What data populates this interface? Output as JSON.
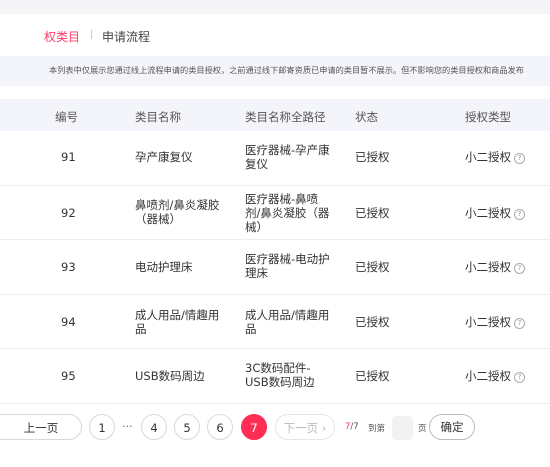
{
  "tabs": {
    "active": "权类目",
    "other": "申请流程"
  },
  "notice": "本列表中仅展示您通过线上流程申请的类目授权，之前通过线下邮寄资质已申请的类目暂不展示。但不影响您的类目授权和商品发布",
  "table": {
    "headers": [
      "编号",
      "类目名称",
      "类目名称全路径",
      "状态",
      "授权类型"
    ],
    "rows": [
      {
        "id": "91",
        "name": "孕产康复仪",
        "path": "医疗器械-孕产康复仪",
        "status": "已授权",
        "auth": "小二授权"
      },
      {
        "id": "92",
        "name": "鼻喷剂/鼻炎凝胶（器械）",
        "path": "医疗器械-鼻喷剂/鼻炎凝胶（器械）",
        "status": "已授权",
        "auth": "小二授权"
      },
      {
        "id": "93",
        "name": "电动护理床",
        "path": "医疗器械-电动护理床",
        "status": "已授权",
        "auth": "小二授权"
      },
      {
        "id": "94",
        "name": "成人用品/情趣用品",
        "path": "成人用品/情趣用品",
        "status": "已授权",
        "auth": "小二授权"
      },
      {
        "id": "95",
        "name": "USB数码周边",
        "path": "3C数码配件-USB数码周边",
        "status": "已授权",
        "auth": "小二授权"
      }
    ],
    "help_glyph": "?"
  },
  "pager": {
    "prev": "上一页",
    "pages": [
      "1",
      "4",
      "5",
      "6",
      "7"
    ],
    "ellipsis": "···",
    "next": "下一页 ›",
    "current": "7",
    "total": "/7",
    "goto_label": "到第",
    "page_unit": "页",
    "confirm": "确定",
    "active_color": "#ff2e55"
  }
}
